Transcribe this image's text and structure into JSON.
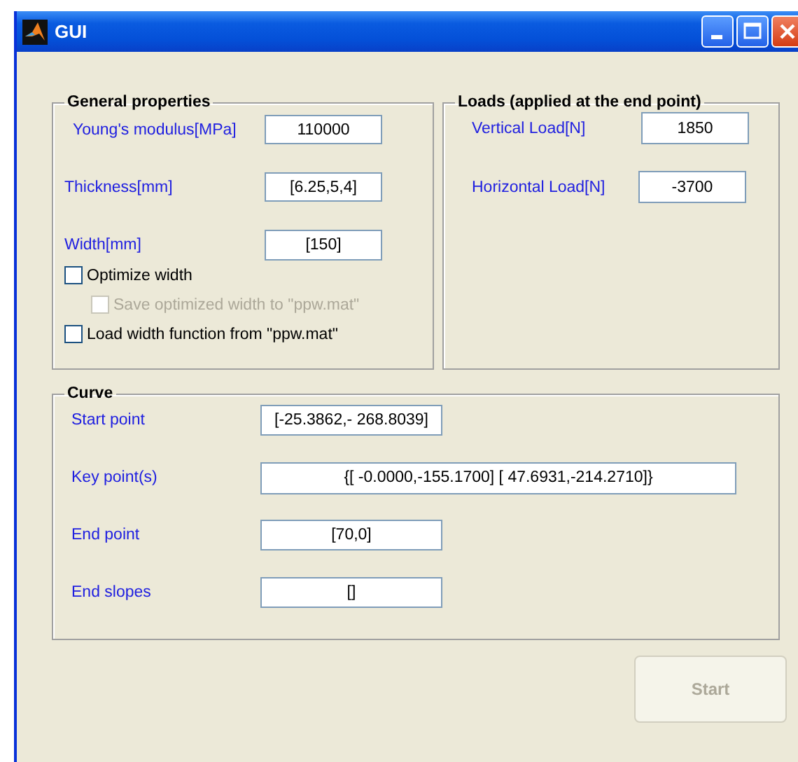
{
  "window": {
    "title": "GUI"
  },
  "general_properties": {
    "title": "General properties",
    "fields": [
      {
        "label": "Young's modulus[MPa]",
        "value": "110000"
      },
      {
        "label": "Thickness[mm]",
        "value": "[6.25,5,4]"
      },
      {
        "label": "Width[mm]",
        "value": "[150]"
      }
    ],
    "checkboxes": [
      {
        "label": "Optimize width",
        "checked": false,
        "disabled": false,
        "children": [
          {
            "label": "Save optimized width to \"ppw.mat\"",
            "checked": false,
            "disabled": true
          }
        ]
      },
      {
        "label": "Load width function from \"ppw.mat\"",
        "checked": false,
        "disabled": false
      }
    ]
  },
  "loads": {
    "title": "Loads (applied at the end point)",
    "fields": [
      {
        "label": "Vertical Load[N]",
        "value": "1850"
      },
      {
        "label": "Horizontal Load[N]",
        "value": "-3700"
      }
    ]
  },
  "curve": {
    "title": "Curve",
    "fields": [
      {
        "label": "Start point",
        "value": "[-25.3862,- 268.8039]"
      },
      {
        "label": "Key point(s)",
        "value": "{[ -0.0000,-155.1700]  [ 47.6931,-214.2710]}"
      },
      {
        "label": "End point",
        "value": "[70,0]"
      },
      {
        "label": "End slopes",
        "value": "[]"
      }
    ]
  },
  "start_button": {
    "label": "Start",
    "disabled": true
  }
}
